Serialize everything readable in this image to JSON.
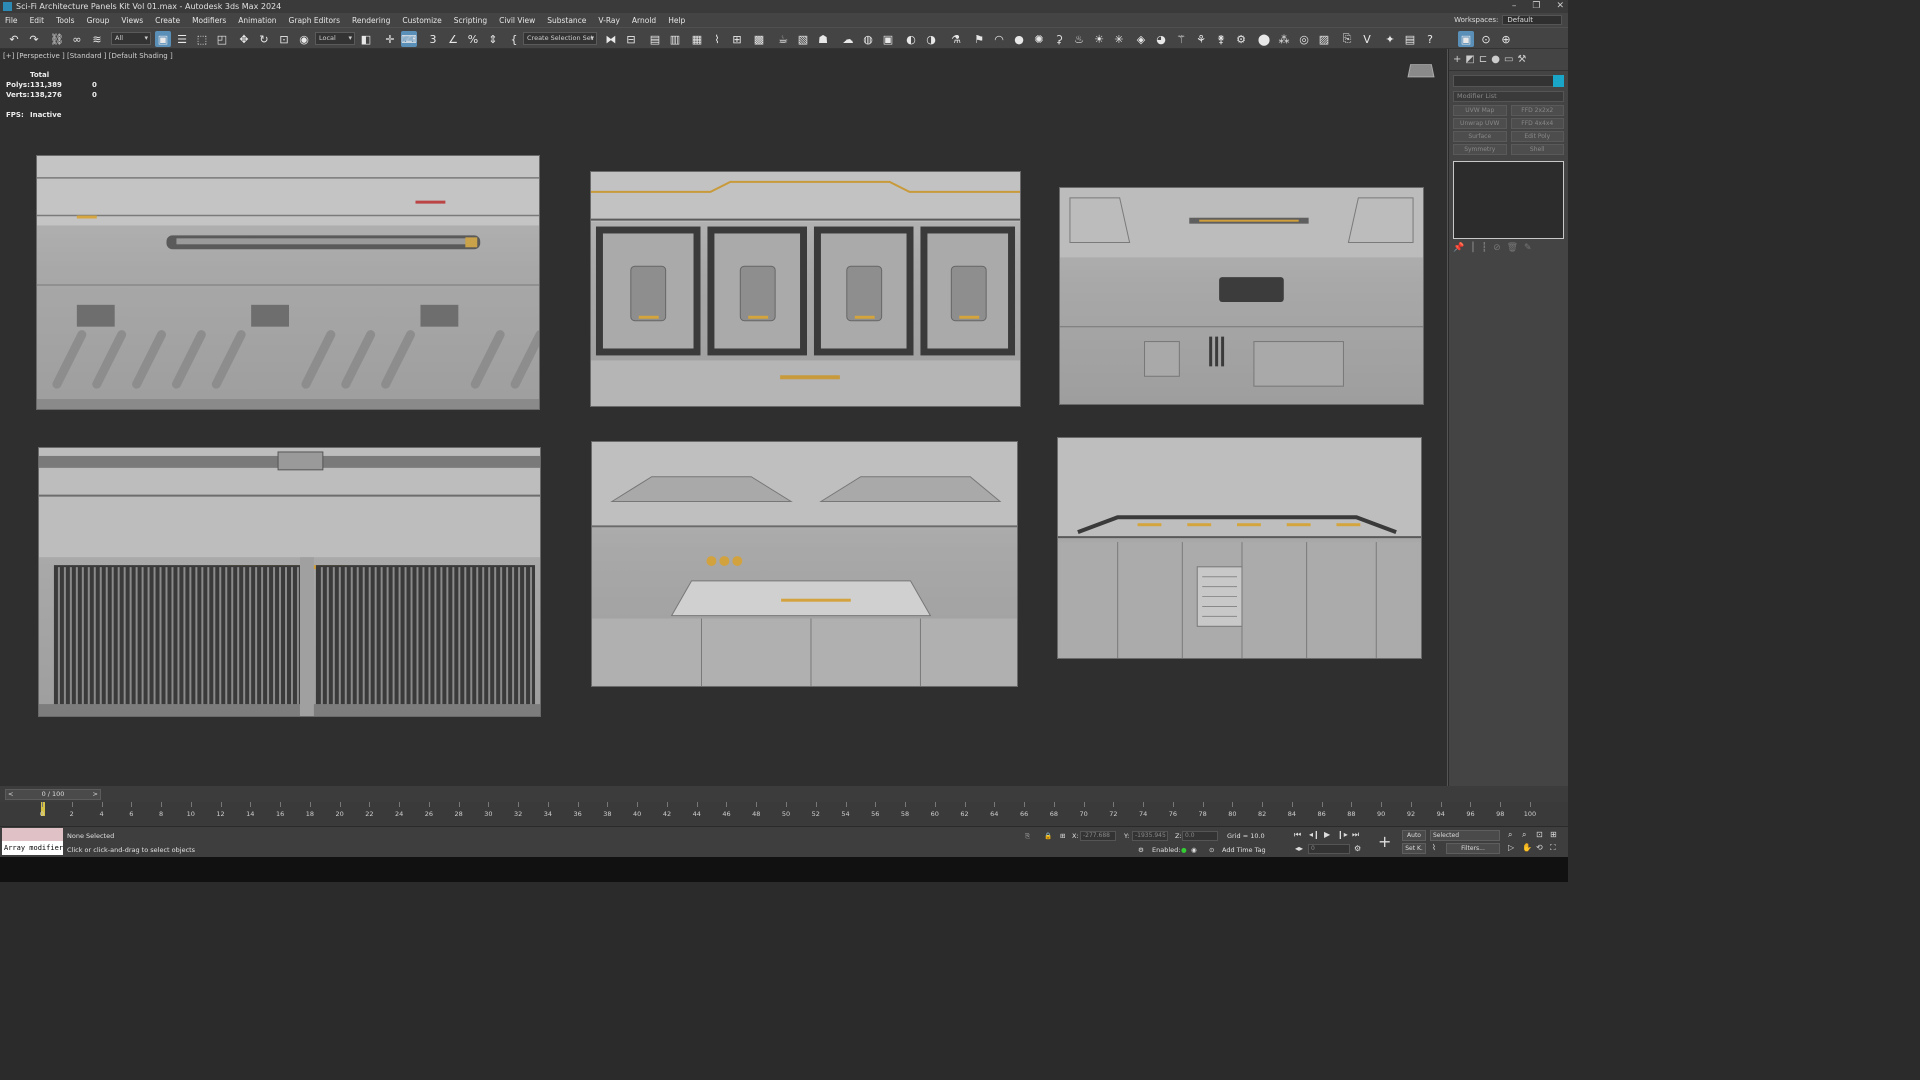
{
  "window": {
    "title": "Sci-Fi Architecture Panels Kit Vol 01.max - Autodesk 3ds Max 2024",
    "controls": [
      "–",
      "❐",
      "✕"
    ]
  },
  "menu": {
    "items": [
      "File",
      "Edit",
      "Tools",
      "Group",
      "Views",
      "Create",
      "Modifiers",
      "Animation",
      "Graph Editors",
      "Rendering",
      "Customize",
      "Scripting",
      "Civil View",
      "Substance",
      "V-Ray",
      "Arnold",
      "Help"
    ],
    "workspaces_label": "Workspaces:",
    "workspaces_value": "Default"
  },
  "toolbar": {
    "selection_filter": "All",
    "reference_coord": "Local",
    "selection_set": "Create Selection Set"
  },
  "viewport": {
    "label": "[+] [Perspective ] [Standard ] [Default Shading ]",
    "stats": {
      "header": "Total",
      "polys_label": "Polys:",
      "polys_value": "131,389",
      "polys_sel": "0",
      "verts_label": "Verts:",
      "verts_value": "138,276",
      "verts_sel": "0",
      "fps_label": "FPS:",
      "fps_value": "Inactive"
    }
  },
  "command_panel": {
    "modifier_list": "Modifier List",
    "buttons": [
      "UVW Map",
      "FFD 2x2x2",
      "Unwrap UVW",
      "FFD 4x4x4",
      "Surface",
      "Edit Poly",
      "Symmetry",
      "Shell"
    ]
  },
  "timeline": {
    "frame_slider": "0 / 100",
    "ticks": [
      "0",
      "2",
      "4",
      "6",
      "8",
      "10",
      "12",
      "14",
      "16",
      "18",
      "20",
      "22",
      "24",
      "26",
      "28",
      "30",
      "32",
      "34",
      "36",
      "38",
      "40",
      "42",
      "44",
      "46",
      "48",
      "50",
      "52",
      "54",
      "56",
      "58",
      "60",
      "62",
      "64",
      "66",
      "68",
      "70",
      "72",
      "74",
      "76",
      "78",
      "80",
      "82",
      "84",
      "86",
      "88",
      "90",
      "92",
      "94",
      "96",
      "98",
      "100"
    ]
  },
  "status": {
    "maxscript_text": "Array modifier",
    "selection": "None Selected",
    "prompt": "Click or click-and-drag to select objects",
    "x_label": "X:",
    "x_value": "-277.688",
    "y_label": "Y:",
    "y_value": "-1935.945",
    "z_label": "Z:",
    "z_value": "0.0",
    "grid": "Grid = 10.0",
    "enabled": "Enabled:",
    "add_time_tag": "Add Time Tag",
    "auto": "Auto",
    "set_key": "Set K.",
    "selected": "Selected",
    "filters": "Filters...",
    "frame_field": "0"
  }
}
